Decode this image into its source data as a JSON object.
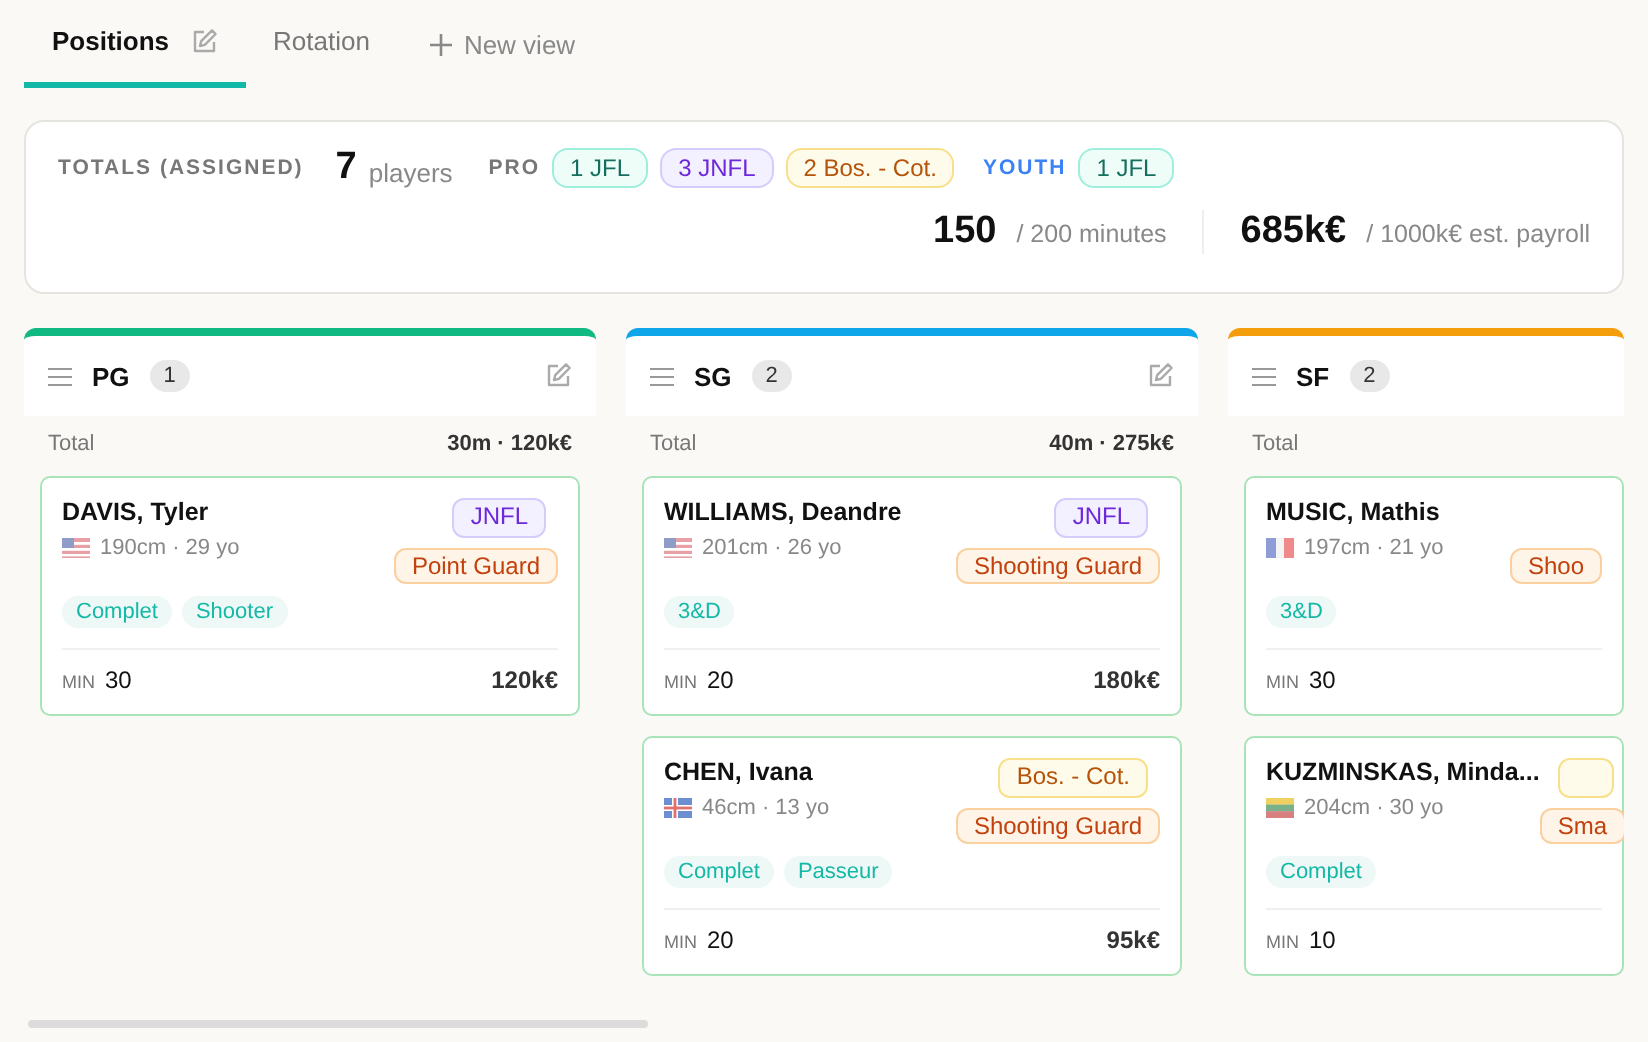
{
  "tabs": [
    {
      "label": "Positions",
      "selected": true,
      "editable": true
    },
    {
      "label": "Rotation",
      "selected": false,
      "editable": false
    }
  ],
  "new_view": {
    "label": "New view"
  },
  "totals": {
    "title": "TOTALS (ASSIGNED)",
    "players_count": "7",
    "players_label": "players",
    "groups": [
      {
        "label": "PRO",
        "kind": "pro",
        "chips": [
          {
            "label": "1 JFL",
            "kind": "jfl"
          },
          {
            "label": "3 JNFL",
            "kind": "jnfl"
          },
          {
            "label": "2 Bos. - Cot.",
            "kind": "bos"
          }
        ]
      },
      {
        "label": "YOUTH",
        "kind": "youth",
        "chips": [
          {
            "label": "1 JFL",
            "kind": "jfl"
          }
        ]
      }
    ],
    "minutes": {
      "value": "150",
      "of": "/ 200 minutes"
    },
    "payroll": {
      "value": "685k€",
      "of": "/ 1000k€ est. payroll"
    }
  },
  "columns": [
    {
      "name": "PG",
      "count": "1",
      "color": "#10b981",
      "total_label": "Total",
      "total_value": "30m · 120k€",
      "cards": [
        {
          "name": "DAVIS, Tyler",
          "flag": {
            "kind": "us"
          },
          "meta": "190cm · 29 yo",
          "league": {
            "kind": "jnfl",
            "label": "JNFL"
          },
          "position": "Point Guard",
          "tags": [
            "Complet",
            "Shooter"
          ],
          "min_label": "MIN",
          "minutes": "30",
          "salary": "120k€"
        }
      ]
    },
    {
      "name": "SG",
      "count": "2",
      "color": "#0ea5e9",
      "total_label": "Total",
      "total_value": "40m · 275k€",
      "cards": [
        {
          "name": "WILLIAMS, Deandre",
          "flag": {
            "kind": "us"
          },
          "meta": "201cm · 26 yo",
          "league": {
            "kind": "jnfl",
            "label": "JNFL"
          },
          "position": "Shooting Guard",
          "tags": [
            "3&D"
          ],
          "min_label": "MIN",
          "minutes": "20",
          "salary": "180k€"
        },
        {
          "name": "CHEN, Ivana",
          "flag": {
            "kind": "is"
          },
          "meta": "46cm · 13 yo",
          "league": {
            "kind": "bos",
            "label": "Bos. - Cot."
          },
          "position": "Shooting Guard",
          "tags": [
            "Complet",
            "Passeur"
          ],
          "min_label": "MIN",
          "minutes": "20",
          "salary": "95k€"
        }
      ]
    },
    {
      "name": "SF",
      "count": "2",
      "color": "#f59e0b",
      "total_label": "Total",
      "cards": [
        {
          "name": "MUSIC, Mathis",
          "flag": {
            "kind": "fr"
          },
          "meta": "197cm · 21 yo",
          "position": "Shoo",
          "tags": [
            "3&D"
          ],
          "min_label": "MIN",
          "minutes": "30"
        },
        {
          "name": "KUZMINSKAS, Minda...",
          "flag": {
            "kind": "lt"
          },
          "meta": "204cm · 30 yo",
          "league": {
            "kind": "bos"
          },
          "position": "Sma",
          "tags": [
            "Complet"
          ],
          "min_label": "MIN",
          "minutes": "10"
        }
      ]
    }
  ]
}
